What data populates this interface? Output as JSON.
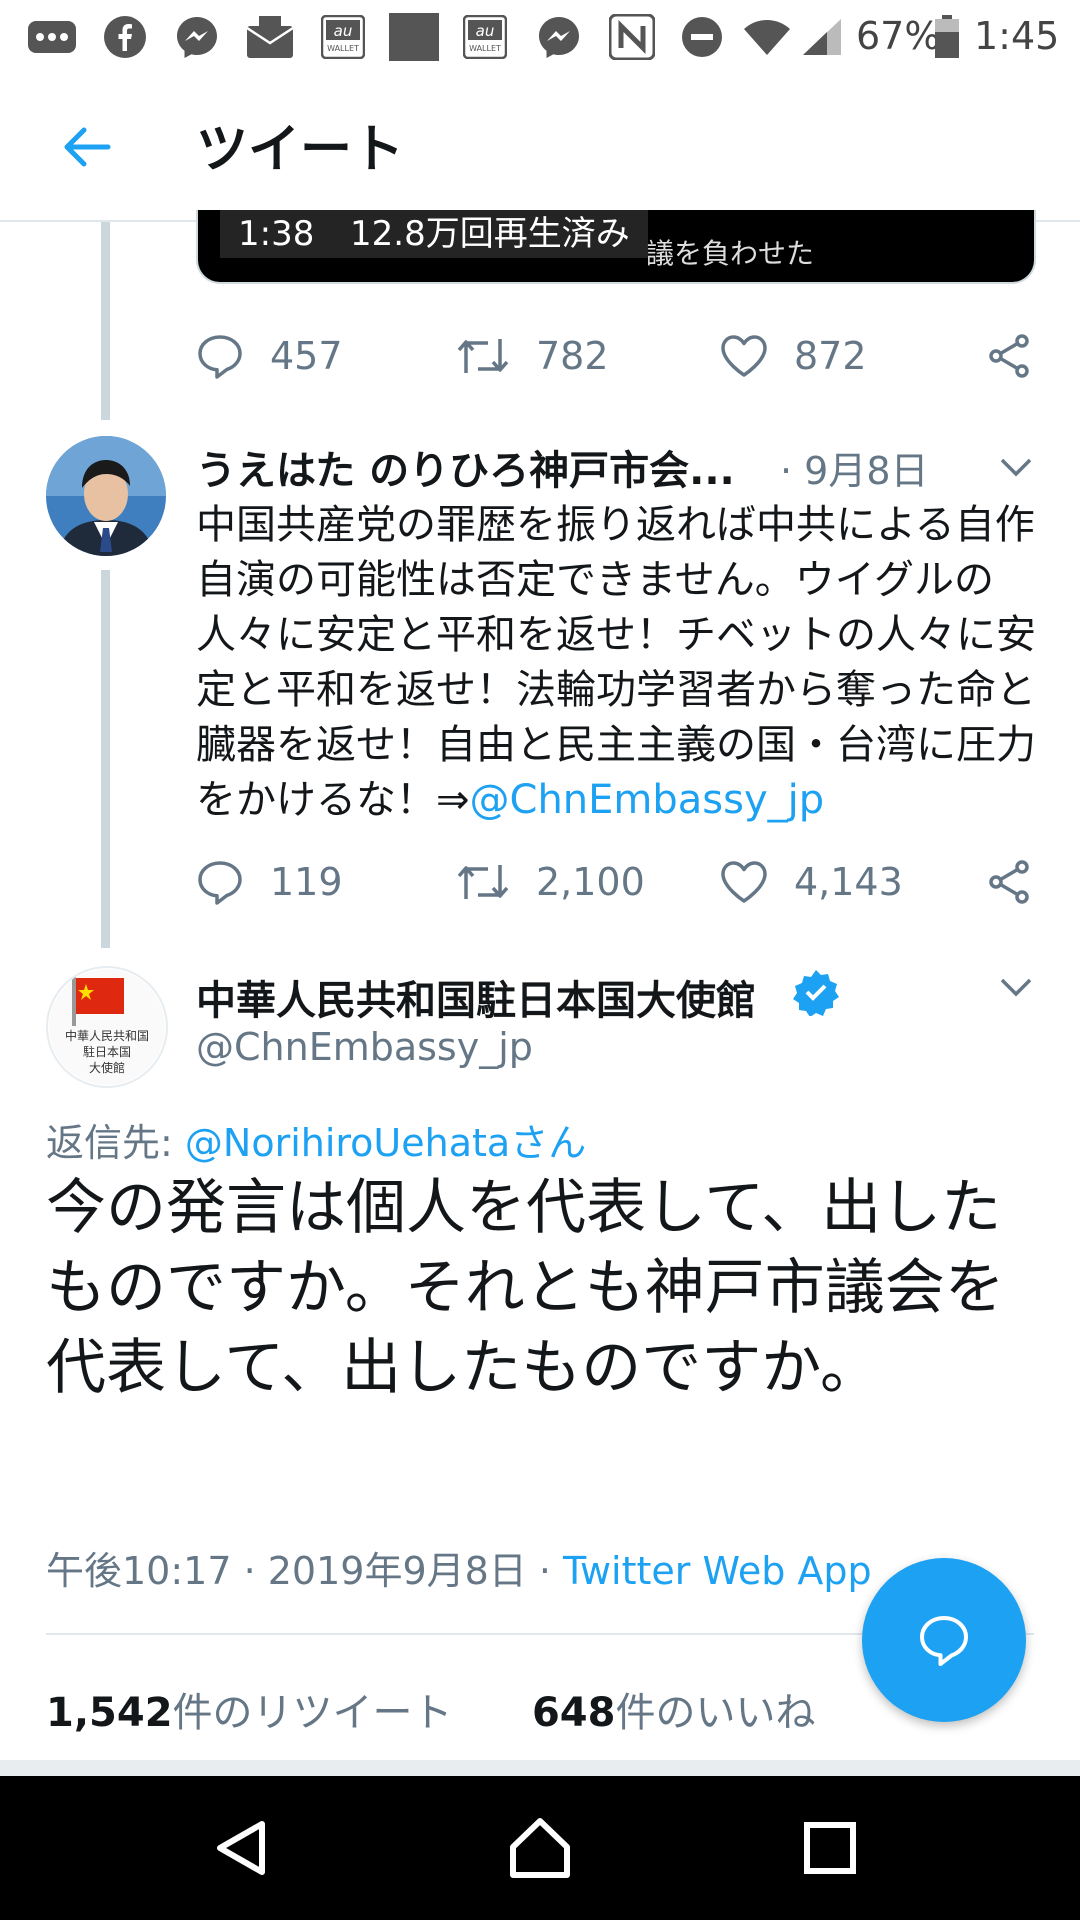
{
  "status_bar": {
    "icons": [
      "more-icon",
      "facebook-icon",
      "messenger-icon",
      "mail-icon",
      "au-wallet-icon",
      "image-icon",
      "au-wallet-icon",
      "messenger-icon",
      "nfc-icon",
      "do-not-disturb-icon",
      "wifi-icon",
      "signal-icon",
      "battery-icon"
    ],
    "au_label": "au",
    "wallet_label": "WALLET",
    "battery": "67%",
    "time": "1:45"
  },
  "header": {
    "title": "ツイート"
  },
  "video": {
    "duration": "1:38",
    "views": "12.8万回再生済み",
    "subtitle": "議を負わせた"
  },
  "tweet1": {
    "replies": "457",
    "retweets": "782",
    "likes": "872"
  },
  "tweet2": {
    "author": "うえはた のりひろ神戸市会...",
    "date": "· 9月8日",
    "text": "中国共産党の罪歴を振り返れば中共による自作自演の可能性は否定できません。ウイグルの人々に安定と平和を返せ！チベットの人々に安定と平和を返せ！法輪功学習者から奪った命と臓器を返せ！自由と民主主義の国・台湾に圧力をかけるな！⇒",
    "mention": "@ChnEmbassy_jp",
    "replies": "119",
    "retweets": "2,100",
    "likes": "4,143"
  },
  "main_tweet": {
    "author": "中華人民共和国駐日本国大使館",
    "handle": "@ChnEmbassy_jp",
    "avatar_text_1": "中華人民共和国",
    "avatar_text_2": "駐日本国",
    "avatar_text_3": "大使館",
    "reply_label": "返信先: ",
    "reply_mention": "@NorihiroUehata",
    "reply_suffix": "さん",
    "text": "今の発言は個人を代表して、出したものですか。それとも神戸市議会を代表して、出したものですか。",
    "time": "午後10:17 · 2019年9月8日 · ",
    "source": "Twitter Web App",
    "retweet_count": "1,542",
    "retweet_label": "件のリツイート",
    "like_count": "648",
    "like_label": "件のいいね"
  },
  "colors": {
    "accent": "#1da1f2",
    "muted": "#657786",
    "text": "#14171a"
  }
}
